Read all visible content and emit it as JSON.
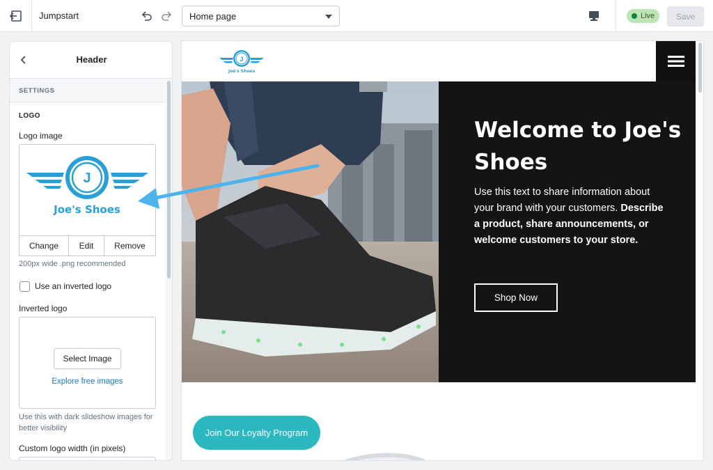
{
  "topbar": {
    "theme_name": "Jumpstart",
    "page_selector": {
      "selected": "Home page"
    },
    "live_label": "Live",
    "save_label": "Save"
  },
  "sidebar": {
    "title": "Header",
    "section_label": "SETTINGS",
    "logo_heading": "LOGO",
    "logo_image_label": "Logo image",
    "logo_preview_text": "Joe's Shoes",
    "logo_letter": "J",
    "logo_buttons": [
      "Change",
      "Edit",
      "Remove"
    ],
    "logo_hint": "200px wide .png recommended",
    "inverted_checkbox_label": "Use an inverted logo",
    "inverted_checked": false,
    "inverted_logo_label": "Inverted logo",
    "select_image_label": "Select Image",
    "explore_link": "Explore free images",
    "inverted_hint": "Use this with dark slideshow images for better visibility",
    "width_label": "Custom logo width (in pixels)"
  },
  "preview": {
    "logo_text": "Joe's Shoes",
    "logo_letter": "J",
    "hero_title": "Welcome to Joe's Shoes",
    "hero_text_plain": "Use this text to share information about your brand with your customers.",
    "hero_text_bold": "Describe a product, share announcements, or welcome customers to your store.",
    "shop_button": "Shop Now",
    "loyalty_button": "Join Our Loyalty Program"
  },
  "colors": {
    "brand_blue": "#2a9fd6",
    "live_green": "#108043",
    "loyalty_teal": "#2bb8c0",
    "hero_dark": "#141414",
    "annotation_arrow": "#4db3ec"
  }
}
